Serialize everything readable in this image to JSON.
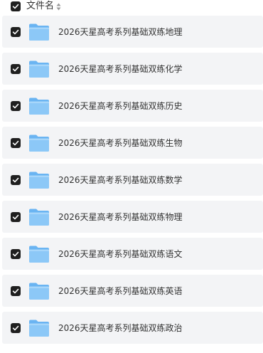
{
  "header": {
    "select_all_checked": true,
    "column_label": "文件名"
  },
  "files": [
    {
      "name": "2026天星高考系列基础双练地理",
      "checked": true
    },
    {
      "name": "2026天星高考系列基础双练化学",
      "checked": true
    },
    {
      "name": "2026天星高考系列基础双练历史",
      "checked": true
    },
    {
      "name": "2026天星高考系列基础双练生物",
      "checked": true
    },
    {
      "name": "2026天星高考系列基础双练数学",
      "checked": true
    },
    {
      "name": "2026天星高考系列基础双练物理",
      "checked": true
    },
    {
      "name": "2026天星高考系列基础双练语文",
      "checked": true
    },
    {
      "name": "2026天星高考系列基础双练英语",
      "checked": true
    },
    {
      "name": "2026天星高考系列基础双练政治",
      "checked": true
    }
  ],
  "icons": {
    "checkbox": "check-icon",
    "folder": "folder-icon",
    "sort": "sort-icon"
  },
  "colors": {
    "checkbox_fill": "#1f1f1f",
    "row_background": "#f3f4f6",
    "folder_front": "#8cc8f7",
    "folder_back": "#6ab4f2"
  }
}
